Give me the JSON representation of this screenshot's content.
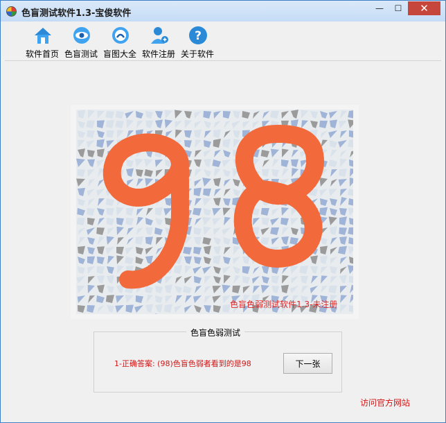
{
  "window": {
    "title": "色盲测试软件1.3-宝俊软件",
    "minimize_glyph": "—",
    "maximize_glyph": "☐",
    "close_glyph": "✕"
  },
  "toolbar": {
    "items": [
      {
        "label": "软件首页",
        "icon": "home-icon"
      },
      {
        "label": "色盲测试",
        "icon": "eye-test-icon"
      },
      {
        "label": "盲图大全",
        "icon": "gallery-icon"
      },
      {
        "label": "软件注册",
        "icon": "user-register-icon"
      },
      {
        "label": "关于软件",
        "icon": "help-icon"
      }
    ]
  },
  "plate": {
    "digits": "98",
    "watermark": "色盲色弱测试软件1.3-未注册",
    "colors": {
      "digit": "#f26a3c",
      "blue": "#9fb4d6",
      "gray": "#9b9b9b",
      "light": "#d9e1ea"
    }
  },
  "test": {
    "group_title": "色盲色弱测试",
    "answer_text": "1-正确答案: (98)色盲色弱者看到的是98",
    "next_button": "下一张"
  },
  "footer": {
    "link_text": "访问官方网站"
  }
}
